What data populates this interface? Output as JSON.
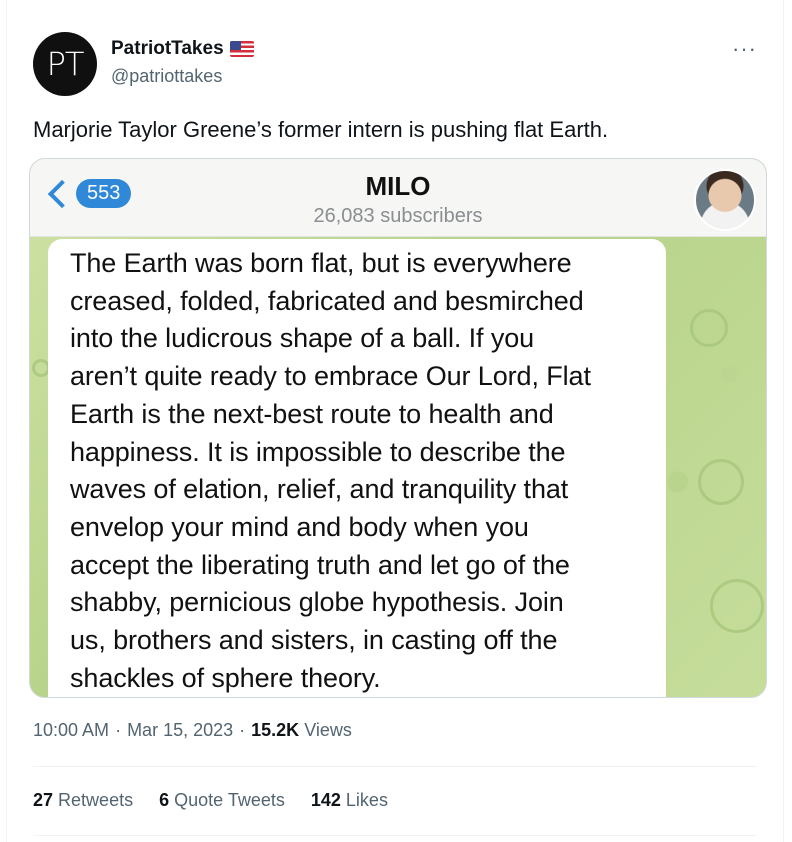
{
  "author": {
    "avatar_initials": "PT",
    "name": "PatriotTakes",
    "handle": "@patriottakes",
    "flag_icon": "us-flag-icon"
  },
  "tweet": {
    "text": "Marjorie Taylor Greene’s former intern is pushing flat Earth.",
    "time": "10:00 AM",
    "date": "Mar 15, 2023",
    "views_count": "15.2K",
    "views_label": "Views"
  },
  "telegram": {
    "back_count": "553",
    "channel_name": "MILO",
    "subscribers": "26,083 subscribers",
    "message": "The Earth was born flat, but is everywhere\ncreased, folded, fabricated and besmirched\ninto the ludicrous shape of a ball. If you\naren’t quite ready to embrace Our Lord, Flat\nEarth is the next-best route to health and\nhappiness. It is impossible to describe the\nwaves of elation, relief, and tranquility that\nenvelop your mind and body when you\naccept the liberating truth and let go of the\nshabby, pernicious globe hypothesis. Join\nus, brothers and sisters, in casting off the\nshackles of sphere theory."
  },
  "stats": {
    "retweets_count": "27",
    "retweets_label": "Retweets",
    "quotes_count": "6",
    "quotes_label": "Quote Tweets",
    "likes_count": "142",
    "likes_label": "Likes"
  },
  "colors": {
    "accent": "#2f89d8",
    "text": "#0f1419",
    "muted": "#536471"
  }
}
